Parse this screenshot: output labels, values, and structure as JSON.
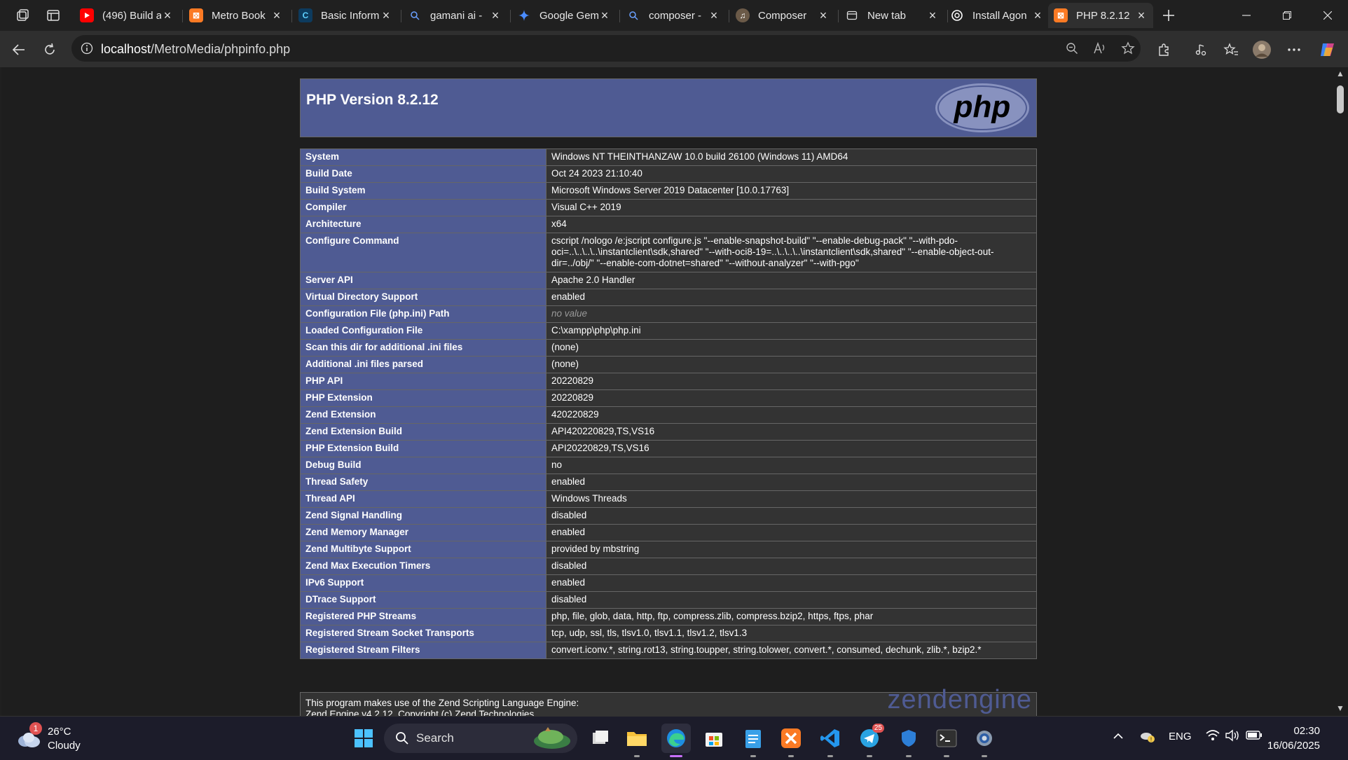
{
  "browser": {
    "tabs": [
      {
        "title": "(496) Build a",
        "icon": "youtube-icon",
        "active": false
      },
      {
        "title": "Metro Book",
        "icon": "xampp-icon",
        "active": false
      },
      {
        "title": "Basic Inform",
        "icon": "cursor-icon",
        "active": false
      },
      {
        "title": "gamani ai -",
        "icon": "search-icon",
        "active": false
      },
      {
        "title": "Google Gem",
        "icon": "gemini-icon",
        "active": false
      },
      {
        "title": "composer -",
        "icon": "search-icon",
        "active": false
      },
      {
        "title": "Composer",
        "icon": "composer-icon",
        "active": false
      },
      {
        "title": "New tab",
        "icon": "new-tab-icon",
        "active": false
      },
      {
        "title": "Install Agon",
        "icon": "chatgpt-icon",
        "active": false
      },
      {
        "title": "PHP 8.2.12",
        "icon": "xampp-icon",
        "active": true
      }
    ],
    "address": {
      "host": "localhost",
      "path": "/MetroMedia/phpinfo.php"
    }
  },
  "page": {
    "title": "PHP Version 8.2.12",
    "logo_text": "php",
    "rows": [
      {
        "name": "System",
        "value": "Windows NT THEINTHANZAW 10.0 build 26100 (Windows 11) AMD64"
      },
      {
        "name": "Build Date",
        "value": "Oct 24 2023 21:10:40"
      },
      {
        "name": "Build System",
        "value": "Microsoft Windows Server 2019 Datacenter [10.0.17763]"
      },
      {
        "name": "Compiler",
        "value": "Visual C++ 2019"
      },
      {
        "name": "Architecture",
        "value": "x64"
      },
      {
        "name": "Configure Command",
        "value": "cscript /nologo /e:jscript configure.js \"--enable-snapshot-build\" \"--enable-debug-pack\" \"--with-pdo-oci=..\\..\\..\\..\\instantclient\\sdk,shared\" \"--with-oci8-19=..\\..\\..\\..\\instantclient\\sdk,shared\" \"--enable-object-out-dir=../obj/\" \"--enable-com-dotnet=shared\" \"--without-analyzer\" \"--with-pgo\""
      },
      {
        "name": "Server API",
        "value": "Apache 2.0 Handler"
      },
      {
        "name": "Virtual Directory Support",
        "value": "enabled"
      },
      {
        "name": "Configuration File (php.ini) Path",
        "value": "no value",
        "novalue": true
      },
      {
        "name": "Loaded Configuration File",
        "value": "C:\\xampp\\php\\php.ini"
      },
      {
        "name": "Scan this dir for additional .ini files",
        "value": "(none)"
      },
      {
        "name": "Additional .ini files parsed",
        "value": "(none)"
      },
      {
        "name": "PHP API",
        "value": "20220829"
      },
      {
        "name": "PHP Extension",
        "value": "20220829"
      },
      {
        "name": "Zend Extension",
        "value": "420220829"
      },
      {
        "name": "Zend Extension Build",
        "value": "API420220829,TS,VS16"
      },
      {
        "name": "PHP Extension Build",
        "value": "API20220829,TS,VS16"
      },
      {
        "name": "Debug Build",
        "value": "no"
      },
      {
        "name": "Thread Safety",
        "value": "enabled"
      },
      {
        "name": "Thread API",
        "value": "Windows Threads"
      },
      {
        "name": "Zend Signal Handling",
        "value": "disabled"
      },
      {
        "name": "Zend Memory Manager",
        "value": "enabled"
      },
      {
        "name": "Zend Multibyte Support",
        "value": "provided by mbstring"
      },
      {
        "name": "Zend Max Execution Timers",
        "value": "disabled"
      },
      {
        "name": "IPv6 Support",
        "value": "enabled"
      },
      {
        "name": "DTrace Support",
        "value": "disabled"
      },
      {
        "name": "Registered PHP Streams",
        "value": "php, file, glob, data, http, ftp, compress.zlib, compress.bzip2, https, ftps, phar"
      },
      {
        "name": "Registered Stream Socket Transports",
        "value": "tcp, udp, ssl, tls, tlsv1.0, tlsv1.1, tlsv1.2, tlsv1.3"
      },
      {
        "name": "Registered Stream Filters",
        "value": "convert.iconv.*, string.rot13, string.toupper, string.tolower, convert.*, consumed, dechunk, zlib.*, bzip2.*"
      }
    ],
    "zend_line1": "This program makes use of the Zend Scripting Language Engine:",
    "zend_line2": "Zend Engine v4.2.12, Copyright (c) Zend Technologies",
    "zend_logo": "zendengine"
  },
  "taskbar": {
    "weather_temp": "26°C",
    "weather_desc": "Cloudy",
    "weather_badge": "1",
    "search_label": "Search",
    "telegram_badge": "25",
    "language": "ENG",
    "time": "02:30",
    "date": "16/06/2025"
  },
  "colors": {
    "php_header": "#4f5b93",
    "row_value_bg": "#333333",
    "page_bg": "#1e1e1e"
  }
}
